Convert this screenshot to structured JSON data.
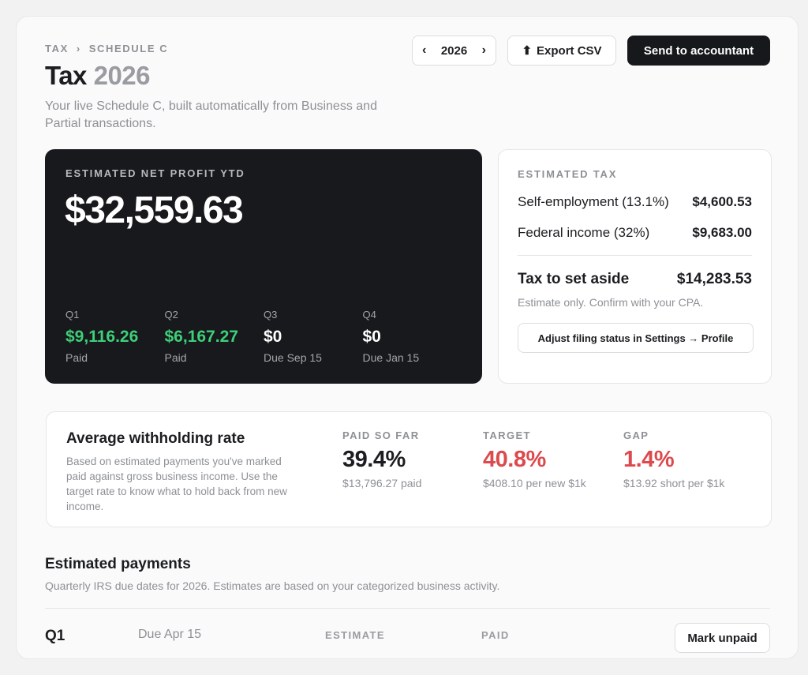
{
  "breadcrumb": {
    "items": [
      "TAX",
      "SCHEDULE C"
    ],
    "separator": "›"
  },
  "header": {
    "title_prefix": "Tax",
    "title_year": "2026",
    "subtitle": "Your live Schedule C, built automatically from Business and Partial transactions."
  },
  "toolbar": {
    "year": "2026",
    "prev_icon": "‹",
    "next_icon": "›",
    "export_icon": "⬆",
    "export_label": "Export CSV",
    "send_label": "Send to accountant"
  },
  "profit": {
    "label": "ESTIMATED NET PROFIT YTD",
    "amount": "$32,559.63",
    "quarters": [
      {
        "label": "Q1",
        "amount": "$9,116.26",
        "status": "Paid",
        "paid": true
      },
      {
        "label": "Q2",
        "amount": "$6,167.27",
        "status": "Paid",
        "paid": true
      },
      {
        "label": "Q3",
        "amount": "$0",
        "status": "Due Sep 15",
        "paid": false
      },
      {
        "label": "Q4",
        "amount": "$0",
        "status": "Due Jan 15",
        "paid": false
      }
    ]
  },
  "estimated_tax": {
    "label": "ESTIMATED TAX",
    "rows": [
      {
        "name": "Self-employment (13.1%)",
        "value": "$4,600.53"
      },
      {
        "name": "Federal income (32%)",
        "value": "$9,683.00"
      }
    ],
    "aside_label": "Tax to set aside",
    "aside_value": "$14,283.53",
    "note": "Estimate only. Confirm with your CPA.",
    "adjust_label": "Adjust filing status in Settings → Profile"
  },
  "withholding": {
    "title": "Average withholding rate",
    "description": "Based on estimated payments you've marked paid against gross business income. Use the target rate to know what to hold back from new income.",
    "metrics": [
      {
        "label": "PAID SO FAR",
        "value": "39.4%",
        "sub": "$13,796.27 paid",
        "highlight": false
      },
      {
        "label": "TARGET",
        "value": "40.8%",
        "sub": "$408.10 per new $1k",
        "highlight": true
      },
      {
        "label": "GAP",
        "value": "1.4%",
        "sub": "$13.92 short per $1k",
        "highlight": true
      }
    ]
  },
  "payments": {
    "title": "Estimated payments",
    "subtitle": "Quarterly IRS due dates for 2026. Estimates are based on your categorized business activity.",
    "rows": [
      {
        "quarter": "Q1",
        "due": "Due Apr 15",
        "estimate_label": "ESTIMATE",
        "paid_label": "PAID",
        "action_label": "Mark unpaid"
      }
    ]
  },
  "colors": {
    "paid_green": "#3ecf79",
    "alert_red": "#dc4a4d",
    "dark_card": "#17191c",
    "muted_text": "#8e9096"
  }
}
